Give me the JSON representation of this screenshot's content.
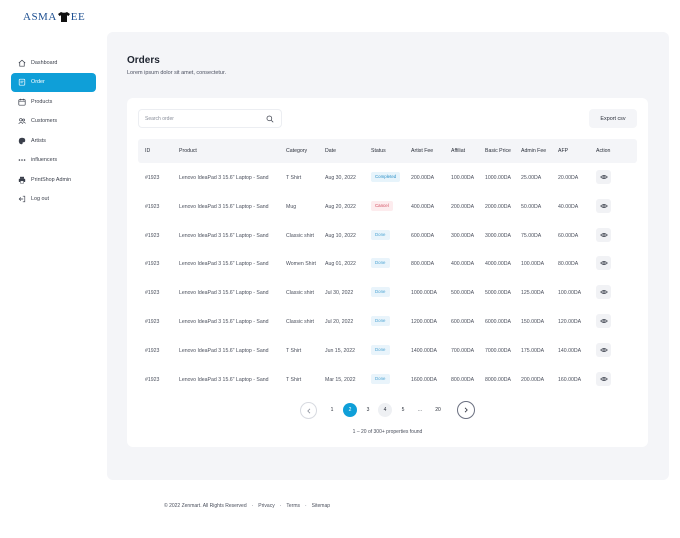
{
  "brand": {
    "name_left": "ASMA",
    "name_right": "EE"
  },
  "sidebar": {
    "items": [
      {
        "label": "Dashboard",
        "icon": "home-icon",
        "active": false
      },
      {
        "label": "Order",
        "icon": "clipboard-icon",
        "active": true
      },
      {
        "label": "Products",
        "icon": "calendar-icon",
        "active": false
      },
      {
        "label": "Customers",
        "icon": "users-icon",
        "active": false
      },
      {
        "label": "Artists",
        "icon": "palette-icon",
        "active": false
      },
      {
        "label": "influencers",
        "icon": "dots-icon",
        "active": false
      },
      {
        "label": "PrintShop Admin",
        "icon": "printer-icon",
        "active": false
      },
      {
        "label": "Log out",
        "icon": "logout-icon",
        "active": false
      }
    ]
  },
  "page": {
    "title": "Orders",
    "subtitle": "Lorem ipsum dolor sit amet, consectetur."
  },
  "search": {
    "placeholder": "Search order",
    "value": ""
  },
  "toolbar": {
    "export_label": "Export csv"
  },
  "table": {
    "headers": [
      "ID",
      "Product",
      "Category",
      "Date",
      "Status",
      "Artist Fee",
      "Affiliat",
      "Basic Price",
      "Admin Fee",
      "AFP",
      "Action"
    ],
    "rows": [
      {
        "id": "#1923",
        "product": "Lenovo IdeaPad 3 15.6\" Laptop - Sand",
        "category": "T Shirt",
        "date": "Aug 30, 2022",
        "status": "Completed",
        "status_type": "completed",
        "artist_fee": "200.00DA",
        "affiliat": "100.00DA",
        "basic_price": "1000.00DA",
        "admin_fee": "25.00DA",
        "afp": "20.00DA"
      },
      {
        "id": "#1923",
        "product": "Lenovo IdeaPad 3 15.6\" Laptop - Sand",
        "category": "Mug",
        "date": "Aug 20, 2022",
        "status": "Cancel",
        "status_type": "cancel",
        "artist_fee": "400.00DA",
        "affiliat": "200.00DA",
        "basic_price": "2000.00DA",
        "admin_fee": "50.00DA",
        "afp": "40.00DA"
      },
      {
        "id": "#1923",
        "product": "Lenovo IdeaPad 3 15.6\" Laptop - Sand",
        "category": "Classic shirt",
        "date": "Aug 10, 2022",
        "status": "Done",
        "status_type": "done",
        "artist_fee": "600.00DA",
        "affiliat": "300.00DA",
        "basic_price": "3000.00DA",
        "admin_fee": "75.00DA",
        "afp": "60.00DA"
      },
      {
        "id": "#1923",
        "product": "Lenovo IdeaPad 3 15.6\" Laptop - Sand",
        "category": "Women Shirt",
        "date": "Aug 01, 2022",
        "status": "Done",
        "status_type": "done",
        "artist_fee": "800.00DA",
        "affiliat": "400.00DA",
        "basic_price": "4000.00DA",
        "admin_fee": "100.00DA",
        "afp": "80.00DA"
      },
      {
        "id": "#1923",
        "product": "Lenovo IdeaPad 3 15.6\" Laptop - Sand",
        "category": "Classic shirt",
        "date": "Jul 30, 2022",
        "status": "Done",
        "status_type": "done",
        "artist_fee": "1000.00DA",
        "affiliat": "500.00DA",
        "basic_price": "5000.00DA",
        "admin_fee": "125.00DA",
        "afp": "100.00DA"
      },
      {
        "id": "#1923",
        "product": "Lenovo IdeaPad 3 15.6\" Laptop - Sand",
        "category": "Classic shirt",
        "date": "Jul 20, 2022",
        "status": "Done",
        "status_type": "done",
        "artist_fee": "1200.00DA",
        "affiliat": "600.00DA",
        "basic_price": "6000.00DA",
        "admin_fee": "150.00DA",
        "afp": "120.00DA"
      },
      {
        "id": "#1923",
        "product": "Lenovo IdeaPad 3 15.6\" Laptop - Sand",
        "category": "T Shirt",
        "date": "Jun 15, 2022",
        "status": "Done",
        "status_type": "done",
        "artist_fee": "1400.00DA",
        "affiliat": "700.00DA",
        "basic_price": "7000.00DA",
        "admin_fee": "175.00DA",
        "afp": "140.00DA"
      },
      {
        "id": "#1923",
        "product": "Lenovo IdeaPad 3 15.6\" Laptop - Sand",
        "category": "T Shirt",
        "date": "Mar 15, 2022",
        "status": "Done",
        "status_type": "done",
        "artist_fee": "1600.00DA",
        "affiliat": "800.00DA",
        "basic_price": "8000.00DA",
        "admin_fee": "200.00DA",
        "afp": "160.00DA"
      }
    ],
    "row_action_icon": "eye-icon"
  },
  "pagination": {
    "pages": [
      "1",
      "2",
      "3",
      "4",
      "5",
      "...",
      "20"
    ],
    "current": "2",
    "prev_icon": "chevron-left-icon",
    "next_icon": "chevron-right-icon",
    "summary": "1 – 20 of 300+ properties found"
  },
  "footer": {
    "copyright": "© 2022 Zenmart. All Rights Reserved",
    "links": [
      "Privacy",
      "Terms",
      "Sitemap"
    ]
  },
  "colors": {
    "accent": "#0f9fd8",
    "panel": "#f4f5f8",
    "brand": "#1d4f91"
  }
}
